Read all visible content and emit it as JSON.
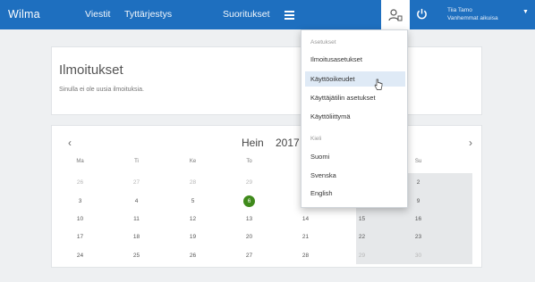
{
  "topbar": {
    "brand": "Wilma",
    "nav": [
      "Viestit",
      "Tyttärjestys",
      "Suoritukset"
    ],
    "user_name": "Tiia Tamo",
    "user_sub": "Vanhemmat aikuisa"
  },
  "notifications": {
    "title": "Ilmoitukset",
    "empty": "Sinulla ei ole uusia ilmoituksia."
  },
  "calendar": {
    "prev": "‹",
    "next": "›",
    "month": "Hein",
    "year": "2017",
    "weekdays": [
      "Ma",
      "Ti",
      "Ke",
      "To",
      "Pe",
      "La",
      "Su"
    ],
    "weeks": [
      [
        "26",
        "27",
        "28",
        "29",
        "30",
        "1",
        "2"
      ],
      [
        "3",
        "4",
        "5",
        "6",
        "7",
        "8",
        "9"
      ],
      [
        "10",
        "11",
        "12",
        "13",
        "14",
        "15",
        "16"
      ],
      [
        "17",
        "18",
        "19",
        "20",
        "21",
        "22",
        "23"
      ],
      [
        "24",
        "25",
        "26",
        "27",
        "28",
        "29",
        "30"
      ]
    ],
    "today": "6"
  },
  "dropdown": {
    "settings_header": "Asetukset",
    "settings_items": [
      "Ilmoitusasetukset",
      "Käyttöoikeudet",
      "Käyttäjätilin asetukset",
      "Käyttöliittymä"
    ],
    "active_item": "Käyttöoikeudet",
    "lang_header": "Kieli",
    "lang_items": [
      "Suomi",
      "Svenska",
      "English"
    ]
  },
  "colors": {
    "topbar": "#1e6fbf",
    "today": "#3f8a1b",
    "active_item": "#dfeaf6"
  }
}
